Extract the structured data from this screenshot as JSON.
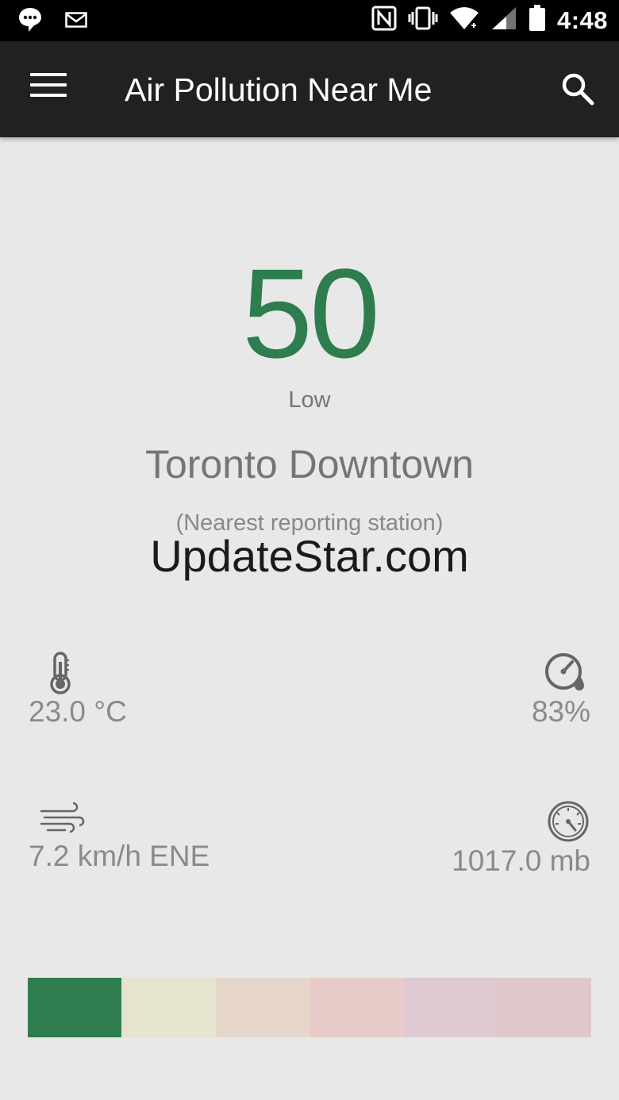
{
  "status_bar": {
    "time": "4:48",
    "icons": [
      "chat-bubble-icon",
      "mail-icon",
      "nfc-icon",
      "vibrate-icon",
      "wifi-icon",
      "cell-signal-icon",
      "battery-icon"
    ]
  },
  "app_bar": {
    "title": "Air Pollution Near Me",
    "menu_icon": "hamburger-menu-icon",
    "search_icon": "search-icon"
  },
  "aqi": {
    "value": "50",
    "level": "Low",
    "accent_color": "#2e7d4f"
  },
  "station": {
    "name": "Toronto Downtown",
    "note": "(Nearest reporting station)"
  },
  "watermark": "UpdateStar.com",
  "metrics": {
    "temperature": {
      "icon": "thermometer-icon",
      "value": "23.0 °C"
    },
    "humidity": {
      "icon": "humidity-gauge-icon",
      "value": "83%"
    },
    "wind": {
      "icon": "wind-icon",
      "value": "7.2 km/h ENE"
    },
    "pressure": {
      "icon": "barometer-icon",
      "value": "1017.0 mb"
    }
  },
  "scale": {
    "colors": [
      "#2e7d4f",
      "#e4e4cf",
      "#e6d7ca",
      "#e8ccca",
      "#dfc9d2",
      "#dec8cb"
    ],
    "active_index": 0
  }
}
